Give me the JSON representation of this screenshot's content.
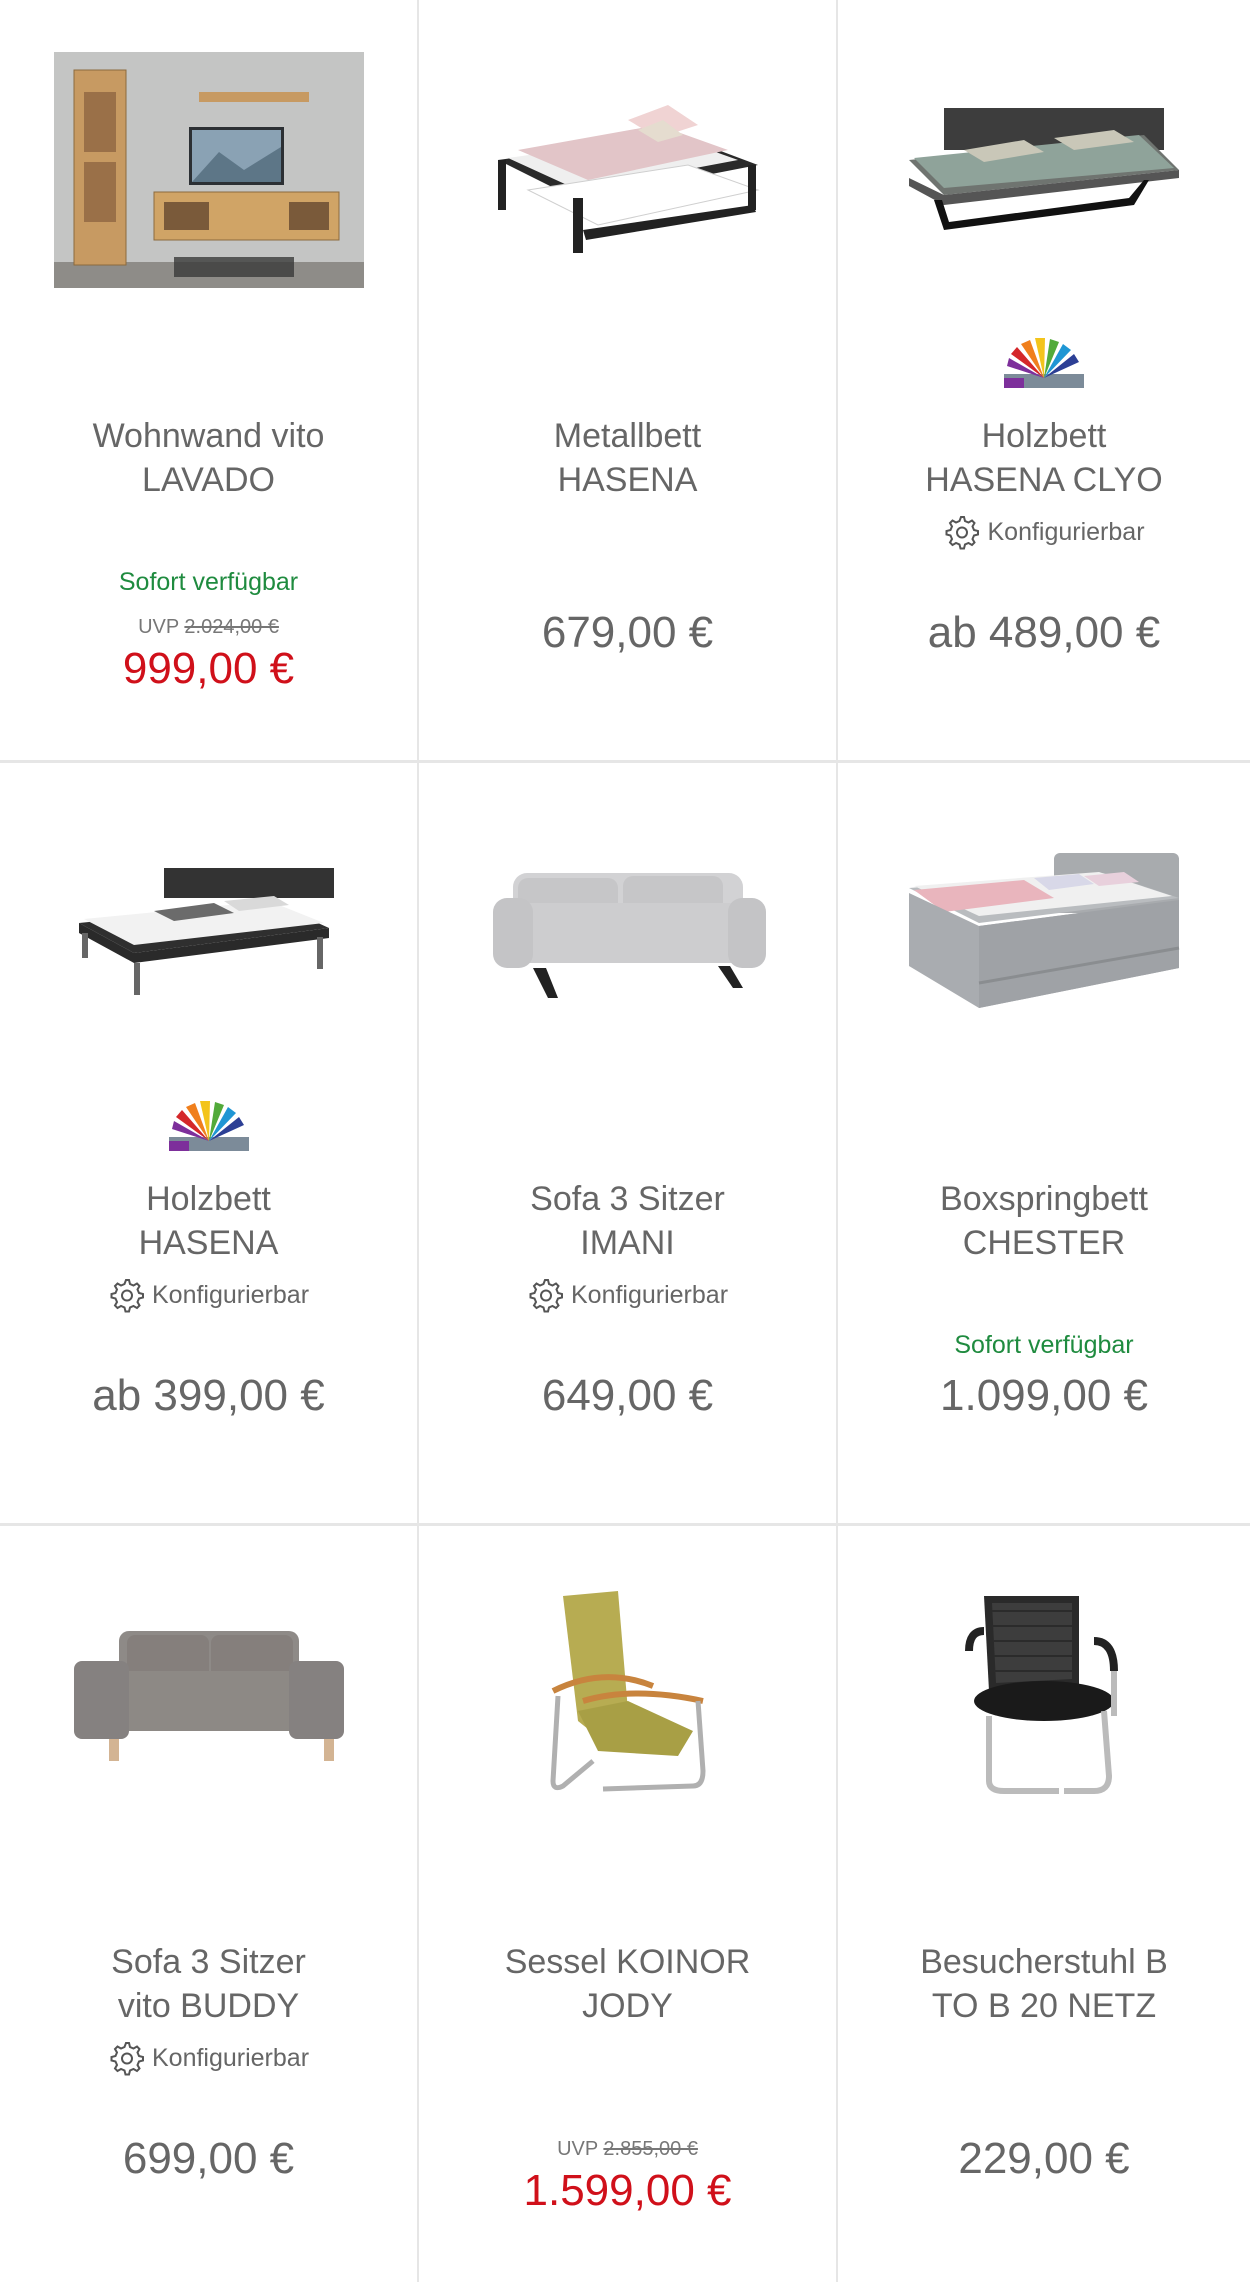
{
  "products": [
    {
      "title_1": "Wohnwand vito",
      "title_2": "LAVADO",
      "availability": "Sofort verfügbar",
      "uvp_label": "UVP",
      "uvp_price": "2.024,00 €",
      "price": "999,00 €"
    },
    {
      "title_1": "Metallbett",
      "title_2": "HASENA",
      "price": "679,00 €"
    },
    {
      "title_1": "Holzbett",
      "title_2": "HASENA CLYO",
      "config": "Konfigurierbar",
      "price": "ab 489,00 €"
    },
    {
      "title_1": "Holzbett",
      "title_2": "HASENA",
      "config": "Konfigurierbar",
      "price": "ab 399,00 €"
    },
    {
      "title_1": "Sofa 3 Sitzer",
      "title_2": "IMANI",
      "config": "Konfigurierbar",
      "price": "649,00 €"
    },
    {
      "title_1": "Boxspringbett",
      "title_2": "CHESTER",
      "availability": "Sofort verfügbar",
      "price": "1.099,00 €"
    },
    {
      "title_1": "Sofa 3 Sitzer",
      "title_2": "vito BUDDY",
      "config": "Konfigurierbar",
      "price": "699,00 €"
    },
    {
      "title_1": "Sessel KOINOR",
      "title_2": "JODY",
      "uvp_label": "UVP",
      "uvp_price": "2.855,00 €",
      "price": "1.599,00 €"
    },
    {
      "title_1": "Besucherstuhl B",
      "title_2": "TO B 20 NETZ",
      "price": "229,00 €"
    }
  ],
  "colors": {
    "sale": "#d0101a",
    "available": "#1f8b3f",
    "text": "#666666",
    "divider": "#e6e6e6"
  },
  "icons": {
    "config": "gear-icon",
    "badge": "color-fan-icon"
  }
}
